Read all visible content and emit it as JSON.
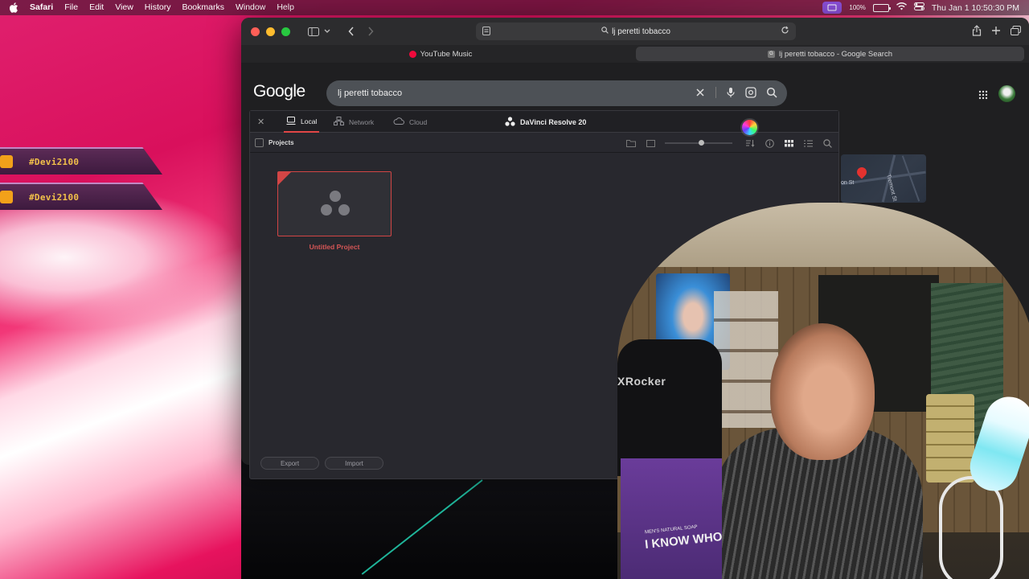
{
  "menubar": {
    "app": "Safari",
    "items": [
      "File",
      "Edit",
      "View",
      "History",
      "Bookmarks",
      "Window",
      "Help"
    ],
    "battery": "100%",
    "clock": "Thu Jan 1  10:50:30 PM"
  },
  "overlay_tags": [
    "#Devi2100",
    "#Devi2100"
  ],
  "safari": {
    "address": "lj peretti tobacco",
    "tabs": [
      {
        "label": "YouTube Music",
        "active": false
      },
      {
        "label": "lj peretti tobacco - Google Search",
        "active": true
      }
    ]
  },
  "google": {
    "logo": "Google",
    "query": "lj peretti tobacco"
  },
  "map": {
    "street_1": "Tremont St",
    "street_2": "on St"
  },
  "resolve": {
    "tabs": [
      "Local",
      "Network",
      "Cloud"
    ],
    "active_tab": "Local",
    "title": "DaVinci Resolve 20",
    "section": "Projects",
    "project_name": "Untitled Project",
    "export_label": "Export",
    "import_label": "Import"
  },
  "webcam": {
    "chair_brand": "XRocker",
    "box_text": "I KNOW WHO",
    "box_label": "MEN'S NATURAL SOAP"
  },
  "colors": {
    "resolve_accent": "#d24545",
    "safari_toolbar": "#2c2c2e",
    "google_searchbox": "#4d5156"
  }
}
